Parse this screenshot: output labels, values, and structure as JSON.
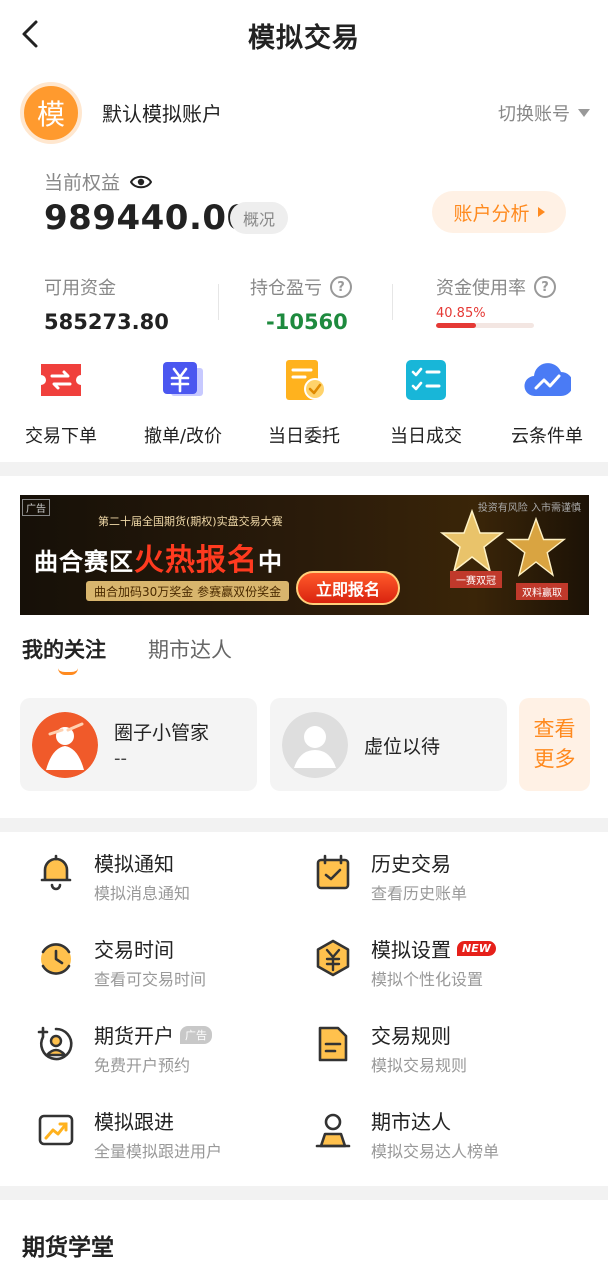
{
  "header": {
    "title": "模拟交易",
    "back_icon": "chevron-left-icon"
  },
  "account": {
    "avatar_char": "模",
    "name": "默认模拟账户",
    "switch_label": "切换账号"
  },
  "equity": {
    "label": "当前权益",
    "value": "989440.00",
    "overview_label": "概况",
    "analysis_label": "账户分析"
  },
  "stats": {
    "available": {
      "label": "可用资金",
      "value": "585273.80"
    },
    "position_pl": {
      "label": "持仓盈亏",
      "value": "-10560",
      "color": "#1e8a3e"
    },
    "usage": {
      "label": "资金使用率",
      "value": "40.85%",
      "fraction": 0.4085,
      "color": "#e53935"
    }
  },
  "quick_actions": [
    {
      "label": "交易下单",
      "icon": "order-ticket-icon"
    },
    {
      "label": "撤单/改价",
      "icon": "cancel-order-icon"
    },
    {
      "label": "当日委托",
      "icon": "daily-entrust-icon"
    },
    {
      "label": "当日成交",
      "icon": "daily-deal-icon"
    },
    {
      "label": "云条件单",
      "icon": "cloud-condition-icon"
    }
  ],
  "banner": {
    "ad_tag": "广告",
    "risk_text": "投资有风险 入市需谨慎",
    "contest_name": "第二十届全国期货(期权)实盘交易大赛",
    "headline_pre": "曲合赛区",
    "headline_hot": "火热报名",
    "headline_post": "中",
    "sub_text": "曲合加码30万奖金 参赛赢双份奖金",
    "button_label": "立即报名",
    "prize1": "¥18888 冠军奖金",
    "prize2": "¥100000 冠军奖金",
    "tag1": "一赛双冠",
    "tag2": "双料赢取"
  },
  "tabs": [
    {
      "label": "我的关注"
    },
    {
      "label": "期市达人"
    }
  ],
  "follow_cards": [
    {
      "name": "圈子小管家",
      "sub": "--"
    },
    {
      "name": "虚位以待",
      "sub": ""
    }
  ],
  "see_more": {
    "line1": "查看",
    "line2": "更多"
  },
  "menu": [
    {
      "title": "模拟通知",
      "sub": "模拟消息通知",
      "icon": "bell-icon"
    },
    {
      "title": "历史交易",
      "sub": "查看历史账单",
      "icon": "calendar-check-icon"
    },
    {
      "title": "交易时间",
      "sub": "查看可交易时间",
      "icon": "clock-icon"
    },
    {
      "title": "模拟设置",
      "sub": "模拟个性化设置",
      "icon": "settings-yen-icon",
      "badge": "NEW"
    },
    {
      "title": "期货开户",
      "sub": "免费开户预约",
      "icon": "account-open-icon",
      "badge": "广告"
    },
    {
      "title": "交易规则",
      "sub": "模拟交易规则",
      "icon": "document-rules-icon"
    },
    {
      "title": "模拟跟进",
      "sub": "全量模拟跟进用户",
      "icon": "trend-chart-icon"
    },
    {
      "title": "期市达人",
      "sub": "模拟交易达人榜单",
      "icon": "expert-user-icon"
    }
  ],
  "school": {
    "title": "期货学堂"
  }
}
